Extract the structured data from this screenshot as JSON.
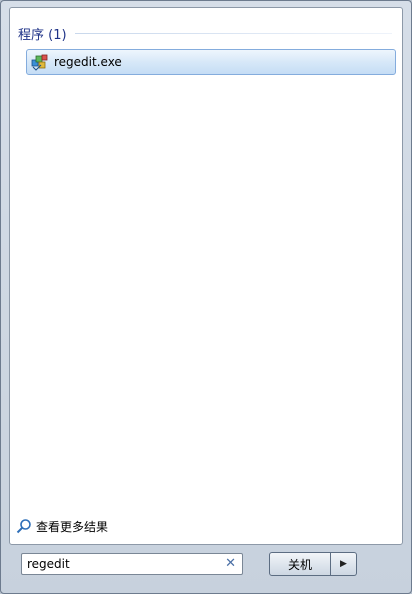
{
  "results": {
    "section_title": "程序 (1)",
    "items": [
      {
        "label": "regedit.exe",
        "icon": "registry-editor-icon"
      }
    ]
  },
  "more_results": {
    "label": "查看更多结果",
    "icon": "magnifier-icon"
  },
  "search": {
    "value": "regedit",
    "clear_icon": "close-icon"
  },
  "power": {
    "label": "关机",
    "arrow_icon": "chevron-right-icon"
  },
  "colors": {
    "section_title": "#1e3287",
    "selected_item_border": "#84acdd",
    "selected_item_fill": "#d7e8f8",
    "menu_frame": "#c7d1dd"
  }
}
